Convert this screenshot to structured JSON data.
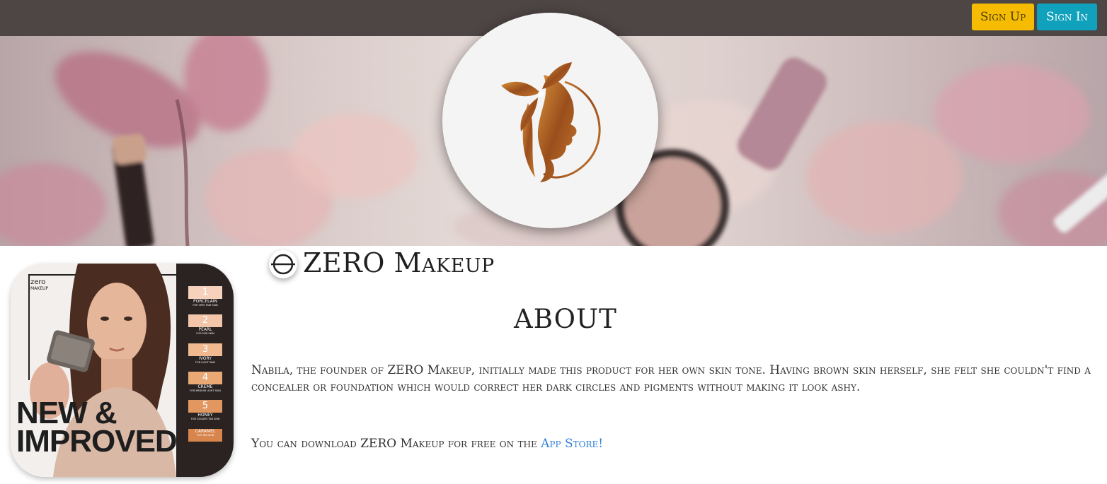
{
  "header": {
    "signup_label": "Sign Up",
    "signin_label": "Sign In",
    "signup_color": "#f6bc04",
    "signin_color": "#10a1bd",
    "bar_color": "#4e4645"
  },
  "brand": {
    "name": "ZERO Makeup",
    "logo_icon": "woman-profile-logo-icon",
    "small_icon": "theta-circle-icon"
  },
  "product_card": {
    "brand_small": "zero",
    "brand_sub": "MAKEUP",
    "headline_line1": "NEW &",
    "headline_line2": "IMPROVED",
    "shades": [
      {
        "num": "1",
        "name": "PORCELAIN",
        "desc": "FOR VERY FAIR SKIN"
      },
      {
        "num": "2",
        "name": "PEARL",
        "desc": "FOR FAIR SKIN"
      },
      {
        "num": "3",
        "name": "IVORY",
        "desc": "FOR LIGHT SKIN"
      },
      {
        "num": "4",
        "name": "CREME",
        "desc": "FOR MEDIUM LIGHT SKIN"
      },
      {
        "num": "5",
        "name": "HONEY",
        "desc": "FOR GOLDEN TAN SKIN"
      },
      {
        "num": "",
        "name": "CARAMEL",
        "desc": "FOR TAN SKIN"
      }
    ]
  },
  "about": {
    "title": "ABOUT",
    "paragraph1": "Nabila, the founder of ZERO Makeup, initially made this product for her own skin tone. Having brown skin herself, she felt she couldn't find a concealer or foundation which would correct her dark circles and pigments without making it look ashy.",
    "paragraph2_prefix": "You can download ZERO Makeup for free on the ",
    "paragraph2_link": "App Store!",
    "link_color": "#2f7fd8"
  }
}
